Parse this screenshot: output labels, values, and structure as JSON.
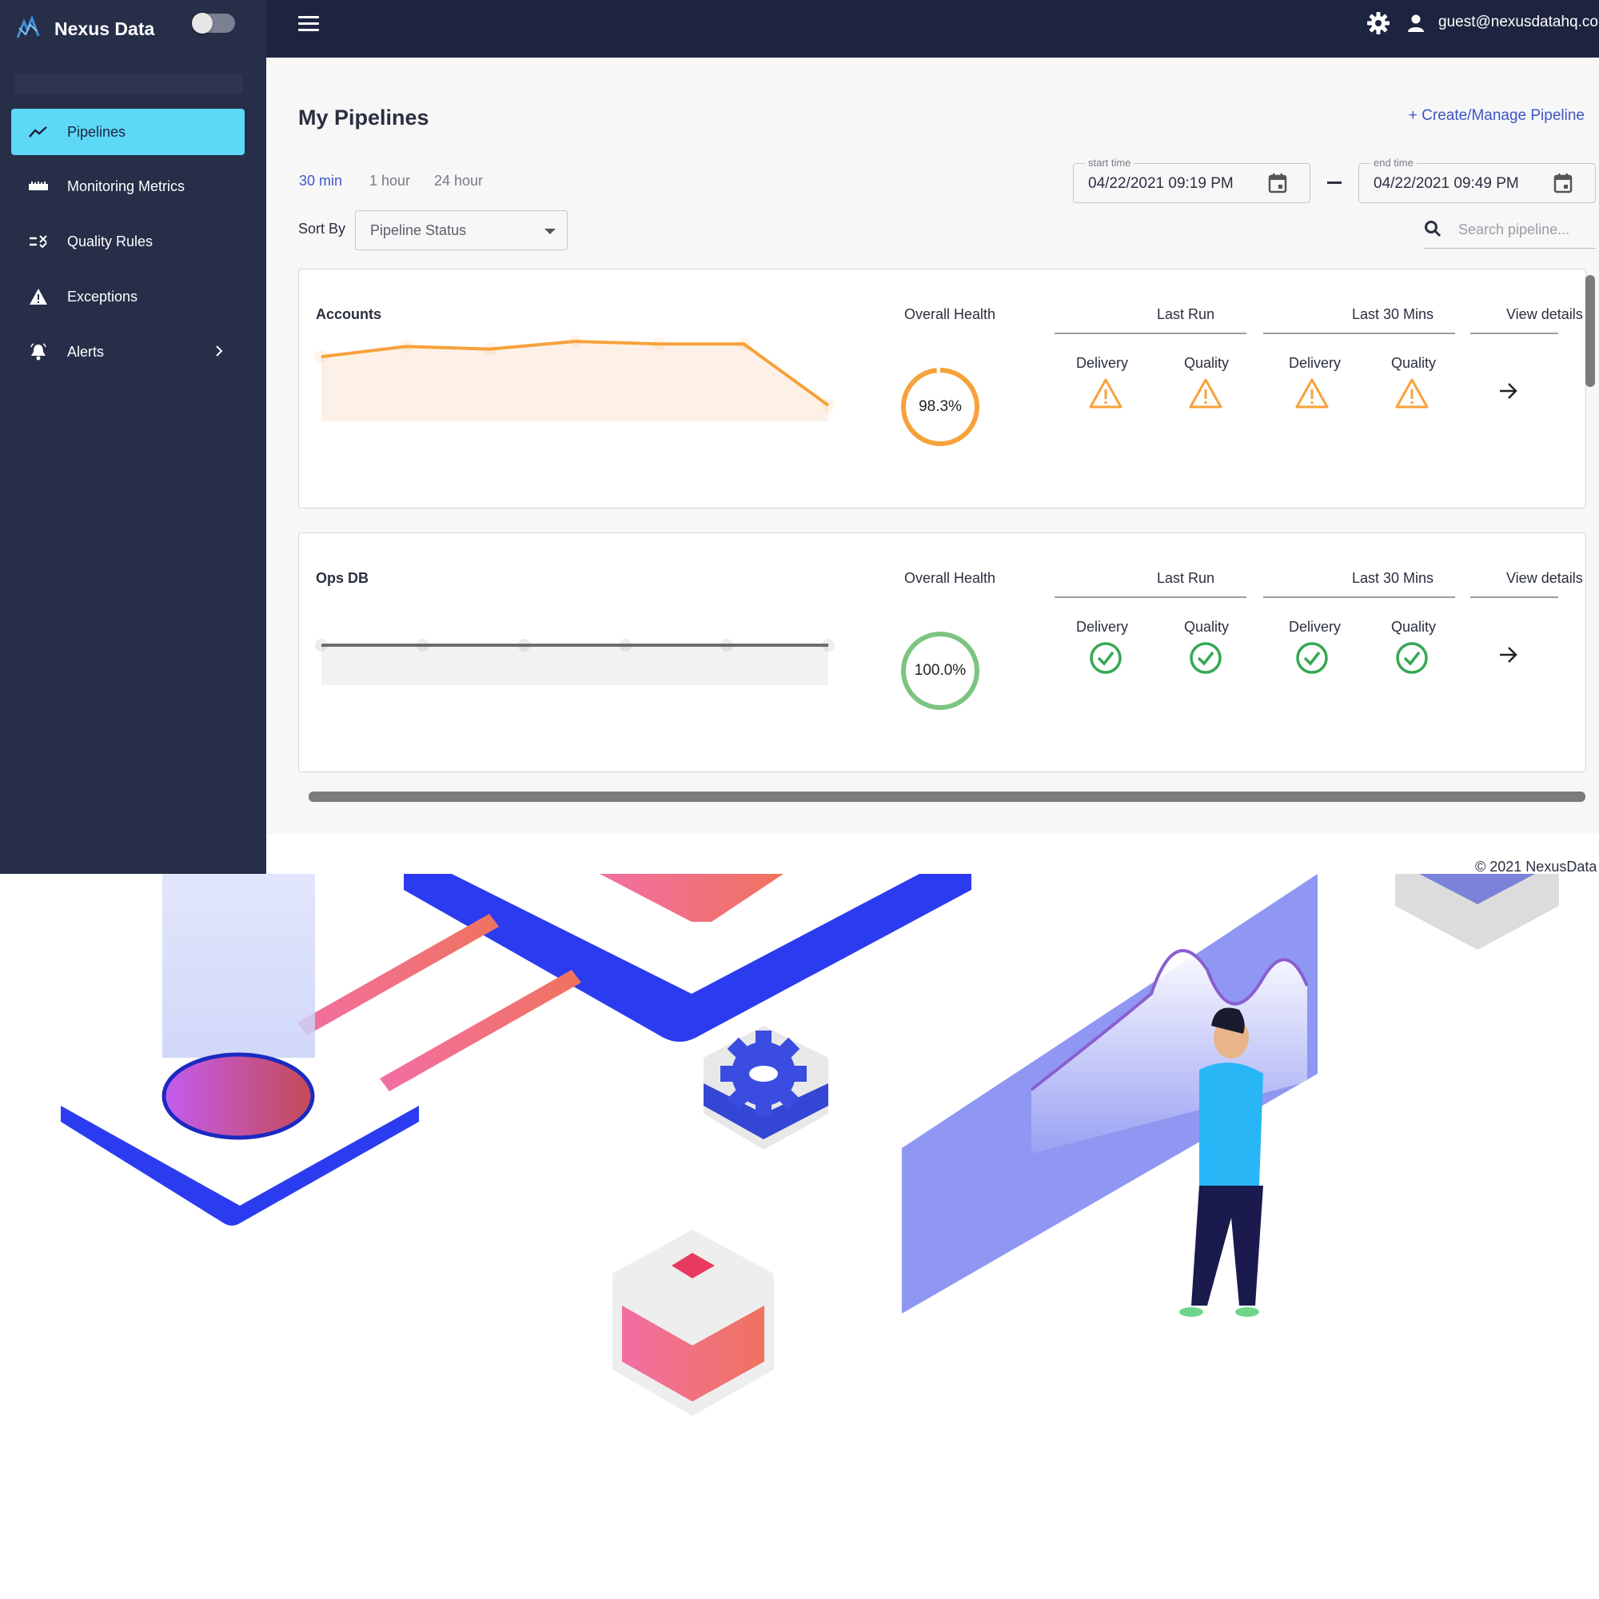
{
  "brand": {
    "name": "Nexus Data"
  },
  "topbar": {
    "user_email": "guest@nexusdatahq.co"
  },
  "sidebar": {
    "items": [
      {
        "label": "Pipelines",
        "icon": "trending-up-icon",
        "active": true
      },
      {
        "label": "Monitoring Metrics",
        "icon": "ruler-icon",
        "active": false
      },
      {
        "label": "Quality Rules",
        "icon": "rule-icon",
        "active": false
      },
      {
        "label": "Exceptions",
        "icon": "warning-icon",
        "active": false
      },
      {
        "label": "Alerts",
        "icon": "bell-icon",
        "active": false,
        "has_submenu": true
      }
    ]
  },
  "main": {
    "title": "My Pipelines",
    "create_label": "+ Create/Manage Pipeline",
    "ranges": [
      "30 min",
      "1 hour",
      "24 hour"
    ],
    "active_range": "30 min",
    "start_time": {
      "label": "start time",
      "value": "04/22/2021 09:19 PM"
    },
    "end_time": {
      "label": "end time",
      "value": "04/22/2021 09:49 PM"
    },
    "sort_label": "Sort By",
    "sort_value": "Pipeline Status",
    "search_placeholder": "Search pipeline..."
  },
  "card_headers": {
    "overall_health": "Overall Health",
    "last_run": "Last Run",
    "last_30": "Last 30 Mins",
    "view_details": "View details",
    "delivery": "Delivery",
    "quality": "Quality"
  },
  "pipelines": [
    {
      "name": "Accounts",
      "health": "98.3%",
      "health_fraction": 0.983,
      "status_color": "#f7a13b",
      "status_icon": "warning-triangle-icon",
      "last_run": {
        "delivery": "warning",
        "quality": "warning"
      },
      "last_30": {
        "delivery": "warning",
        "quality": "warning"
      }
    },
    {
      "name": "Ops DB",
      "health": "100.0%",
      "health_fraction": 1.0,
      "status_color": "#7cc47f",
      "status_icon": "check-circle-icon",
      "last_run": {
        "delivery": "ok",
        "quality": "ok"
      },
      "last_30": {
        "delivery": "ok",
        "quality": "ok"
      }
    }
  ],
  "chart_data": [
    {
      "type": "area",
      "series": [
        {
          "values": [
            98.6,
            99.0,
            98.9,
            99.2,
            99.1,
            99.1,
            96.7
          ]
        }
      ]
    },
    {
      "type": "area",
      "series": [
        {
          "values": [
            100,
            100,
            100,
            100,
            100,
            100
          ]
        }
      ]
    }
  ],
  "footer": {
    "copyright": "© 2021 NexusData"
  },
  "colors": {
    "sidebar_bg": "#272e48",
    "topbar_bg": "#1d2440",
    "active_nav": "#5dd8f7",
    "accent_link": "#3d56c4",
    "warning": "#f7a13b",
    "success": "#7cc47f"
  }
}
